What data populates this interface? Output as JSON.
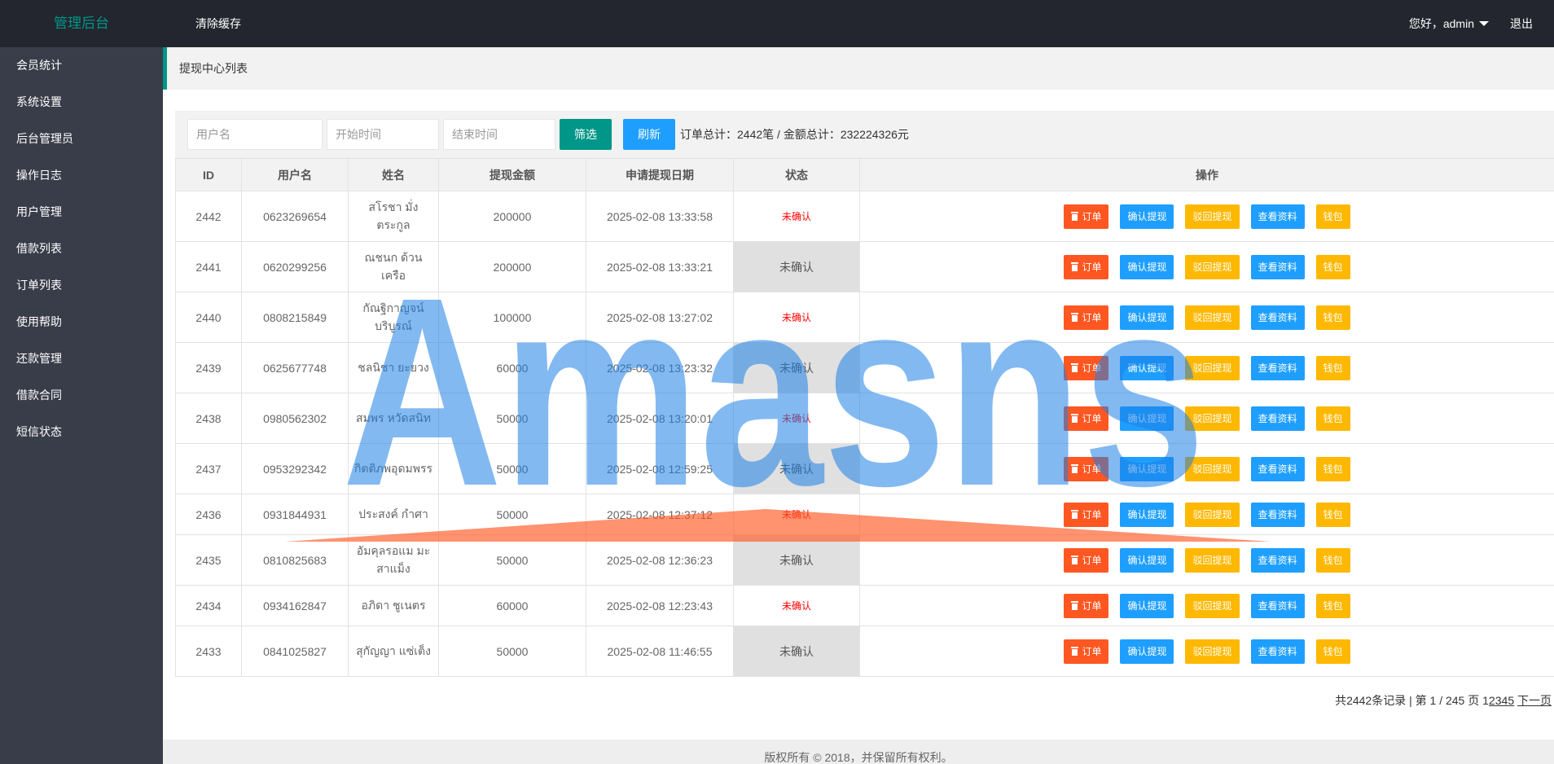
{
  "topbar": {
    "logo": "管理后台",
    "clear_cache": "清除缓存",
    "greeting": "您好，admin",
    "logout": "退出"
  },
  "sidebar": {
    "items": [
      {
        "label": "会员统计"
      },
      {
        "label": "系统设置"
      },
      {
        "label": "后台管理员"
      },
      {
        "label": "操作日志"
      },
      {
        "label": "用户管理"
      },
      {
        "label": "借款列表"
      },
      {
        "label": "订单列表"
      },
      {
        "label": "使用帮助"
      },
      {
        "label": "还款管理"
      },
      {
        "label": "借款合同"
      },
      {
        "label": "短信状态"
      }
    ]
  },
  "breadcrumb": {
    "title": "提现中心列表"
  },
  "filter": {
    "username_placeholder": "用户名",
    "start_placeholder": "开始时间",
    "end_placeholder": "结束时间",
    "filter_label": "筛选",
    "refresh_label": "刷新",
    "summary": "订单总计：2442笔 / 金额总计：232224326元"
  },
  "table": {
    "headers": [
      "ID",
      "用户名",
      "姓名",
      "提现金额",
      "申请提现日期",
      "状态",
      "操作"
    ],
    "actions": {
      "order": "订单",
      "confirm": "确认提现",
      "reject": "驳回提现",
      "view": "查看资料",
      "wallet": "钱包"
    },
    "rows": [
      {
        "id": "2442",
        "username": "0623269654",
        "name": "สโรชา มั่งตระกูล",
        "amount": "200000",
        "date": "2025-02-08 13:33:58",
        "status": "未确认"
      },
      {
        "id": "2441",
        "username": "0620299256",
        "name": "ณชนก ด้วนเครือ",
        "amount": "200000",
        "date": "2025-02-08 13:33:21",
        "status": "未确认"
      },
      {
        "id": "2440",
        "username": "0808215849",
        "name": "กัณฐิกาญจน์ บริบูรณ์",
        "amount": "100000",
        "date": "2025-02-08 13:27:02",
        "status": "未确认"
      },
      {
        "id": "2439",
        "username": "0625677748",
        "name": "ชลนิชา ยะยวง",
        "amount": "60000",
        "date": "2025-02-08 13:23:32",
        "status": "未确认"
      },
      {
        "id": "2438",
        "username": "0980562302",
        "name": "สมพร หวัดสนิท",
        "amount": "50000",
        "date": "2025-02-08 13:20:01",
        "status": "未确认"
      },
      {
        "id": "2437",
        "username": "0953292342",
        "name": "กิตติภพอุดมพรร",
        "amount": "50000",
        "date": "2025-02-08 12:59:25",
        "status": "未确认"
      },
      {
        "id": "2436",
        "username": "0931844931",
        "name": "ประสงค์ กำศา",
        "amount": "50000",
        "date": "2025-02-08 12:37:12",
        "status": "未确认"
      },
      {
        "id": "2435",
        "username": "0810825683",
        "name": "อัมคุลรอแม มะสาแม็ง",
        "amount": "50000",
        "date": "2025-02-08 12:36:23",
        "status": "未确认"
      },
      {
        "id": "2434",
        "username": "0934162847",
        "name": "อภิดา ชูเนตร",
        "amount": "60000",
        "date": "2025-02-08 12:23:43",
        "status": "未确认"
      },
      {
        "id": "2433",
        "username": "0841025827",
        "name": "สุกัญญา แซ่เต็ง",
        "amount": "50000",
        "date": "2025-02-08 11:46:55",
        "status": "未确认"
      }
    ]
  },
  "pager": {
    "summary": "共2442条记录 | 第 1 / 245 页",
    "current": "1",
    "pages": [
      "2",
      "3",
      "4",
      "5"
    ],
    "next": "下一页"
  },
  "footer": {
    "copyright": "版权所有 © 2018，并保留所有权利。"
  },
  "watermark": {
    "text": "Amasns"
  }
}
